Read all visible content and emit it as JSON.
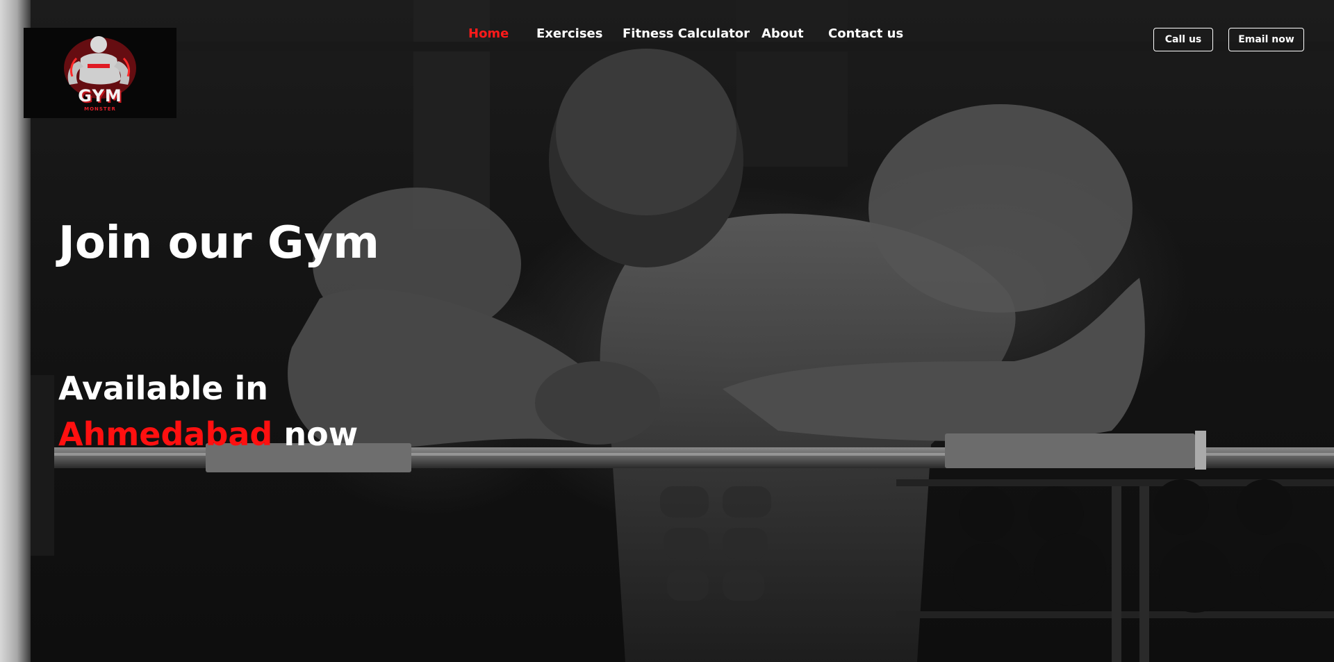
{
  "logo": {
    "title": "GYM",
    "subtitle": "MONSTER"
  },
  "nav": {
    "items": [
      {
        "label": "Home",
        "active": true
      },
      {
        "label": "Exercises",
        "active": false
      },
      {
        "label": "Fitness Calculator",
        "active": false
      },
      {
        "label": "About",
        "active": false
      },
      {
        "label": "Contact us",
        "active": false
      }
    ]
  },
  "actions": {
    "call_label": "Call us",
    "email_label": "Email now"
  },
  "hero": {
    "headline": "Join our Gym",
    "available_prefix": "Available in",
    "city": "Ahmedabad",
    "available_suffix": "now"
  },
  "colors": {
    "accent": "#ff1a1a",
    "text": "#ffffff",
    "background": "#111111"
  },
  "icons": {
    "logo_mascot": "bodybuilder-mascot-icon"
  }
}
